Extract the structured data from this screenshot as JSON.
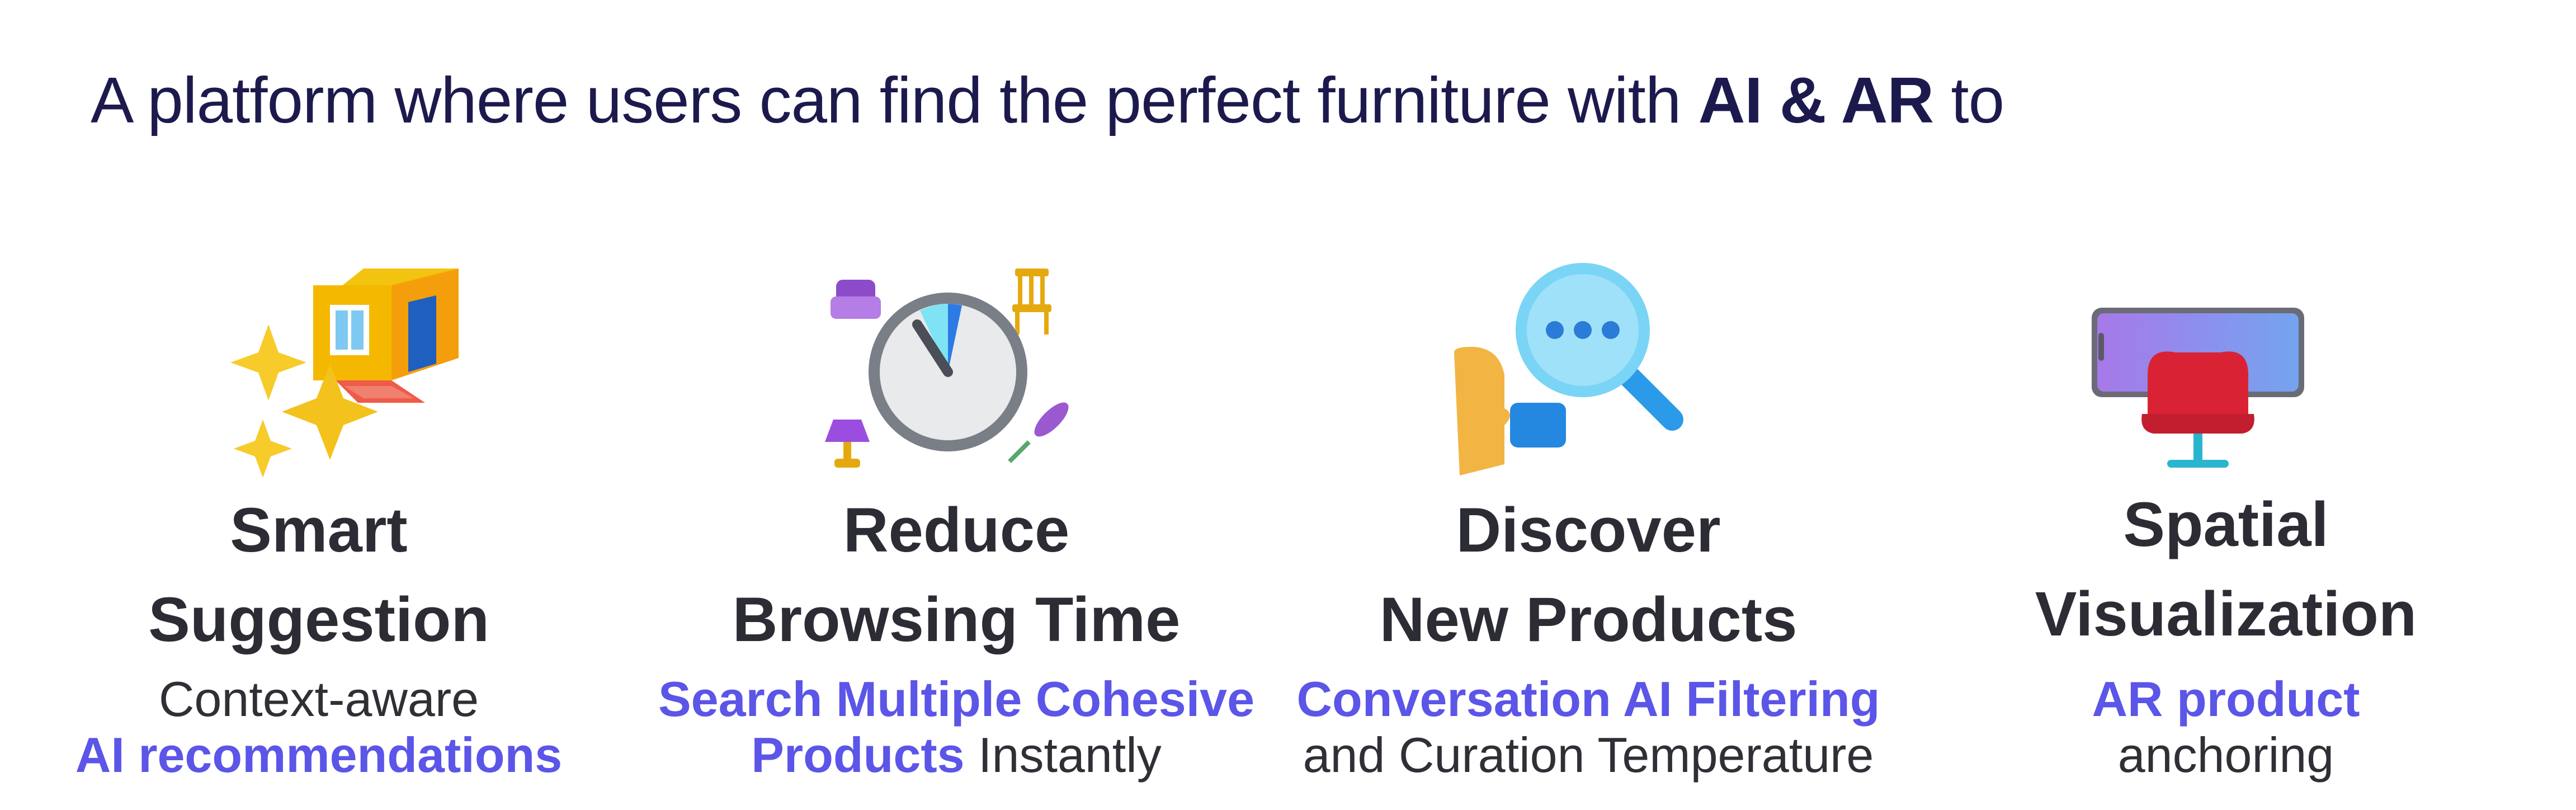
{
  "headline": {
    "prefix": "A platform where users can find the perfect furniture with ",
    "emphasis": "AI & AR",
    "suffix": " to"
  },
  "features": [
    {
      "icon": "house-sparkles-icon",
      "title_line1": "Smart",
      "title_line2": "Suggestion",
      "desc_line1_plain": "Context-aware",
      "desc_line2_accent": "AI recommendations"
    },
    {
      "icon": "stopwatch-furniture-icon",
      "title_line1": "Reduce",
      "title_line2": "Browsing Time",
      "desc_line1_accent": "Search Multiple Cohesive",
      "desc_line2_accent": "Products",
      "desc_line2_plain": " Instantly"
    },
    {
      "icon": "conversation-search-icon",
      "title_line1": "Discover",
      "title_line2": "New Products",
      "desc_line1_accent": "Conversation AI Filtering",
      "desc_line2_plain": "and Curation Temperature"
    },
    {
      "icon": "phone-ar-chair-icon",
      "title_line1": "Spatial",
      "title_line2": "Visualization",
      "desc_line1_accent": "AR product",
      "desc_line2_plain": "anchoring"
    }
  ],
  "colors": {
    "headline": "#1c1a4d",
    "title": "#2c2c34",
    "accent": "#5b55e8",
    "body": "#2f2f36"
  }
}
